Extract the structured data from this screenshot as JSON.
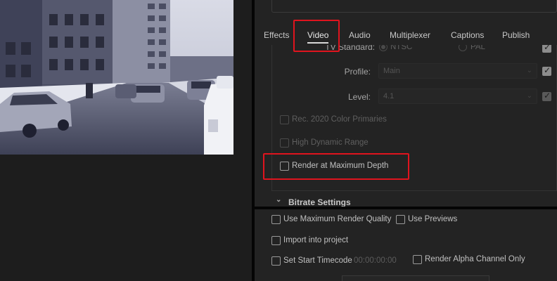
{
  "tabs": [
    {
      "label": "Effects"
    },
    {
      "label": "Video"
    },
    {
      "label": "Audio"
    },
    {
      "label": "Multiplexer"
    },
    {
      "label": "Captions"
    },
    {
      "label": "Publish"
    }
  ],
  "active_tab": "Video",
  "video": {
    "tv_standard_label": "TV Standard:",
    "ntsc_label": "NTSC",
    "pal_label": "PAL",
    "profile_label": "Profile:",
    "profile_value": "Main",
    "level_label": "Level:",
    "level_value": "4.1",
    "rec2020_label": "Rec. 2020 Color Primaries",
    "hdr_label": "High Dynamic Range",
    "render_max_depth_label": "Render at Maximum Depth"
  },
  "bitrate_section_label": "Bitrate Settings",
  "bottom": {
    "max_render_quality_label": "Use Maximum Render Quality",
    "use_previews_label": "Use Previews",
    "import_project_label": "Import into project",
    "start_timecode_label": "Set Start Timecode",
    "start_timecode_value": "00:00:00:00",
    "render_alpha_label": "Render Alpha Channel Only"
  },
  "colors": {
    "highlight": "#e0141e",
    "panel_bg": "#232323",
    "divider": "#050505"
  },
  "icons": {
    "section_toggle": "chevron-down-icon",
    "dropdown": "chevron-down-icon",
    "checkbox_checked": "check-icon"
  }
}
